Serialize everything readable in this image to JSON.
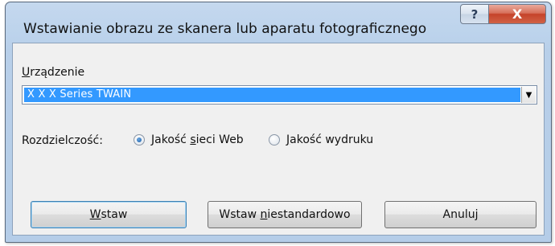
{
  "window": {
    "title": "Wstawianie obrazu ze skanera lub aparatu fotograficznego",
    "help_label": "?",
    "close_label": "X"
  },
  "device": {
    "label_ul": "U",
    "label_rest": "rządzenie",
    "selected": "X X X Series TWAIN"
  },
  "resolution": {
    "label": "Rozdzielczość:",
    "options": [
      {
        "pre": "Jakość ",
        "ul": "s",
        "post": "ieci Web",
        "checked": true
      },
      {
        "pre": "",
        "ul": "J",
        "post": "akość wydruku",
        "checked": false
      }
    ]
  },
  "buttons": {
    "insert": {
      "ul": "W",
      "rest": "staw"
    },
    "custom": {
      "pre": "Wstaw ",
      "ul": "n",
      "rest": "iestandardowo"
    },
    "cancel": {
      "label": "Anuluj"
    }
  },
  "colors": {
    "selection": "#3399ff",
    "close": "#c5432a"
  }
}
